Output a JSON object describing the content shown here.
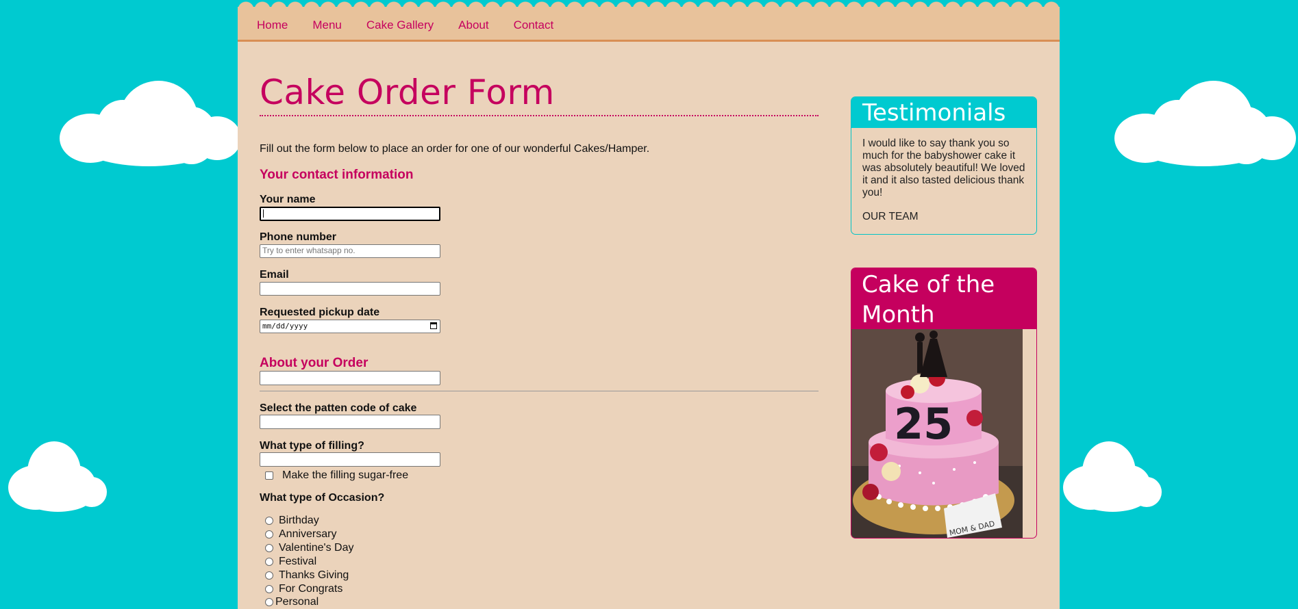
{
  "nav": [
    "Home",
    "Menu",
    "Cake Gallery",
    "About",
    "Contact"
  ],
  "title": "Cake Order Form",
  "intro": "Fill out the form below to place an order for one of our wonderful Cakes/Hamper.",
  "contact": {
    "heading": "Your contact information",
    "name_label": "Your name",
    "phone_label": "Phone number",
    "phone_placeholder": "Try to enter whatsapp no.",
    "email_label": "Email",
    "date_label": "Requested pickup date",
    "date_placeholder": "mm/dd/yyyy"
  },
  "order": {
    "heading": "About your Order",
    "pattern_label": "Select the patten code of cake",
    "filling_label": "What type of filling?",
    "sugar_free_label": "Make the filling sugar-free",
    "occasion_label": "What type of Occasion?",
    "occasions": [
      "Birthday",
      "Anniversary",
      "Valentine's Day",
      "Festival",
      "Thanks Giving",
      "For Congrats",
      "Personal"
    ]
  },
  "testimonials": {
    "heading": "Testimonials",
    "text": "I would like to say thank you so much for the babyshower cake it was absolutely beautiful! We loved it and it also tasted delicious thank you!",
    "signature": "OUR TEAM"
  },
  "cake_of_month": {
    "heading_line1": "Cake of the",
    "heading_line2": "Month",
    "topper_number": "25",
    "plaque_text": "MOM & DAD"
  },
  "colors": {
    "background": "#00cad0",
    "page": "#ebd3bb",
    "accent": "#c5005e",
    "nav": "#e8c29b"
  }
}
